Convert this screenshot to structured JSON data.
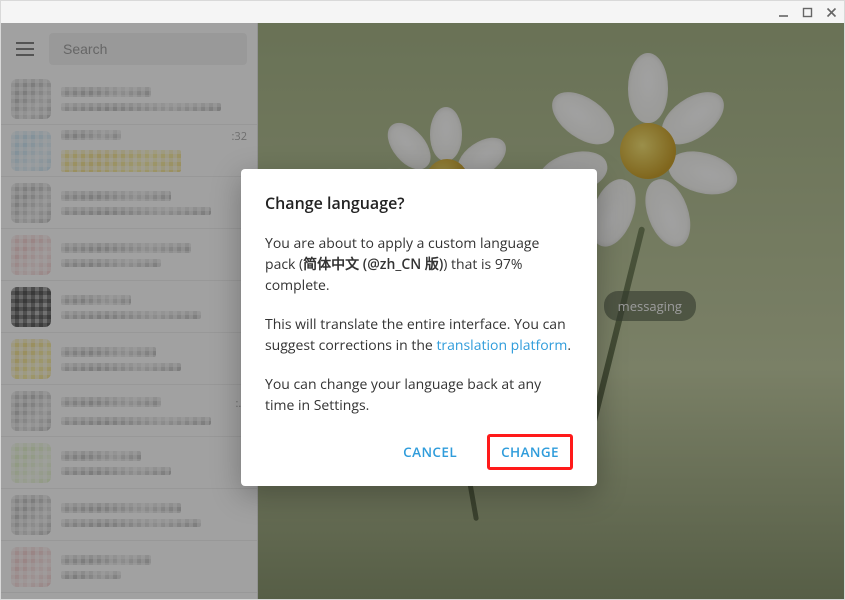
{
  "window": {
    "minimize_icon": "minimize",
    "maximize_icon": "maximize",
    "close_icon": "close"
  },
  "sidebar": {
    "menu_icon": "hamburger",
    "search_placeholder": "Search",
    "items": [
      {
        "time": ""
      },
      {
        "time": ":32"
      },
      {
        "time": ""
      },
      {
        "time": ""
      },
      {
        "time": ""
      },
      {
        "time": ""
      },
      {
        "time": ":…"
      },
      {
        "time": ""
      },
      {
        "time": ""
      },
      {
        "time": ""
      }
    ]
  },
  "chat_area": {
    "background_caption_fragment": "messaging"
  },
  "modal": {
    "title": "Change language?",
    "body_p1_a": "You are about to apply a custom language pack (",
    "body_p1_b": "简体中文 (@zh_CN 版)",
    "body_p1_c": ") that is 97% complete.",
    "body_p2_a": "This will translate the entire interface. You can suggest corrections in the ",
    "body_p2_link": "translation platform",
    "body_p2_b": ".",
    "body_p3": "You can change your language back at any time in Settings.",
    "cancel_label": "CANCEL",
    "confirm_label": "CHANGE"
  }
}
